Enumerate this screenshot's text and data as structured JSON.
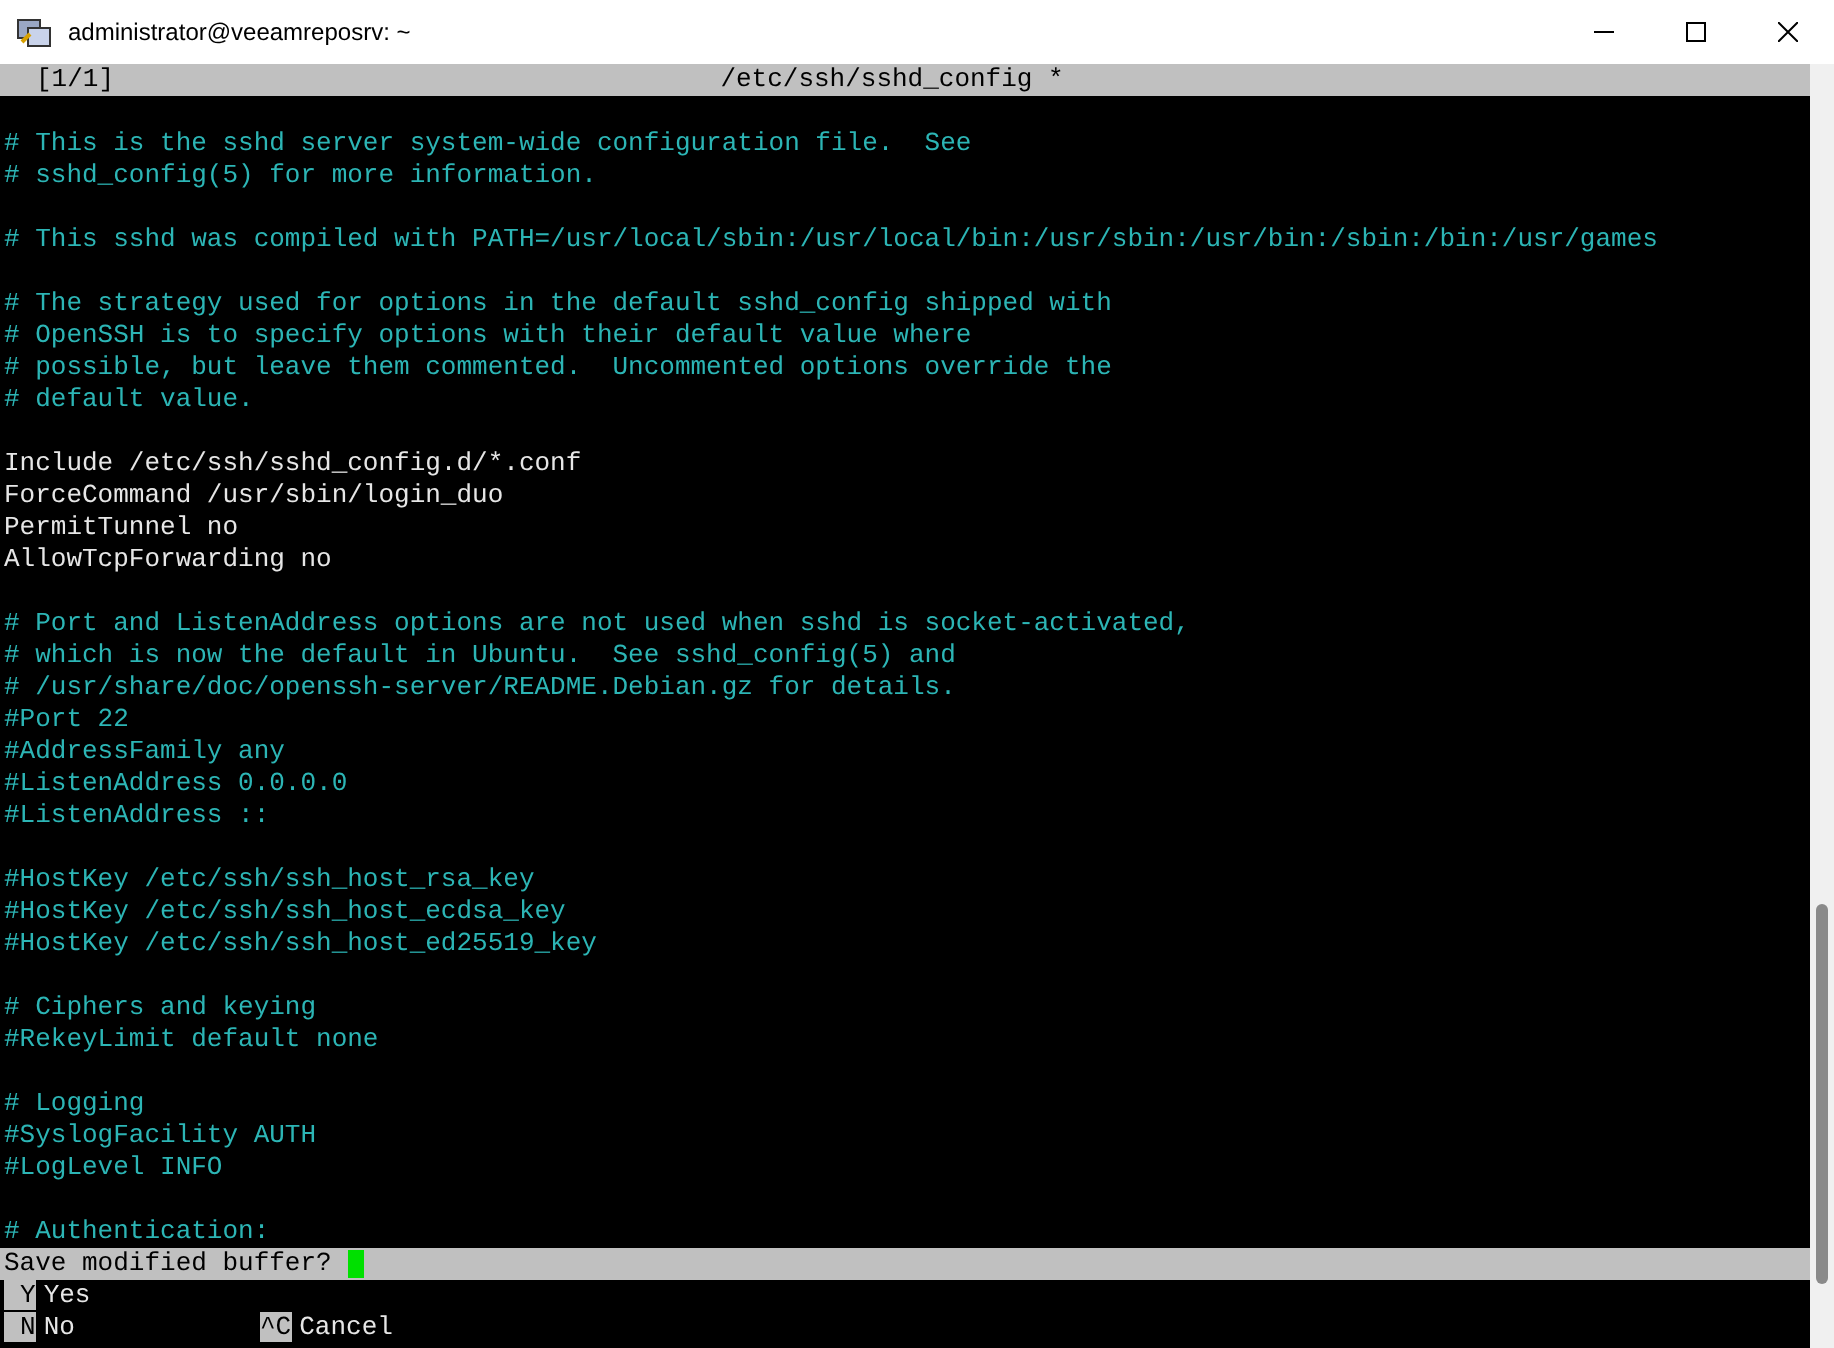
{
  "window": {
    "title": "administrator@veeamreposrv: ~"
  },
  "editor_header": {
    "buffer_count": "[1/1]",
    "file_title": "/etc/ssh/sshd_config *"
  },
  "lines": [
    {
      "kind": "blank"
    },
    {
      "kind": "comment",
      "text": "# This is the sshd server system-wide configuration file.  See"
    },
    {
      "kind": "comment",
      "text": "# sshd_config(5) for more information."
    },
    {
      "kind": "blank"
    },
    {
      "kind": "comment",
      "text": "# This sshd was compiled with PATH=/usr/local/sbin:/usr/local/bin:/usr/sbin:/usr/bin:/sbin:/bin:/usr/games"
    },
    {
      "kind": "blank"
    },
    {
      "kind": "comment",
      "text": "# The strategy used for options in the default sshd_config shipped with"
    },
    {
      "kind": "comment",
      "text": "# OpenSSH is to specify options with their default value where"
    },
    {
      "kind": "comment",
      "text": "# possible, but leave them commented.  Uncommented options override the"
    },
    {
      "kind": "comment",
      "text": "# default value."
    },
    {
      "kind": "blank"
    },
    {
      "kind": "setting",
      "text": "Include /etc/ssh/sshd_config.d/*.conf"
    },
    {
      "kind": "setting",
      "text": "ForceCommand /usr/sbin/login_duo"
    },
    {
      "kind": "setting",
      "text": "PermitTunnel no"
    },
    {
      "kind": "setting",
      "text": "AllowTcpForwarding no"
    },
    {
      "kind": "blank"
    },
    {
      "kind": "comment",
      "text": "# Port and ListenAddress options are not used when sshd is socket-activated,"
    },
    {
      "kind": "comment",
      "text": "# which is now the default in Ubuntu.  See sshd_config(5) and"
    },
    {
      "kind": "comment",
      "text": "# /usr/share/doc/openssh-server/README.Debian.gz for details."
    },
    {
      "kind": "comment",
      "text": "#Port 22"
    },
    {
      "kind": "comment",
      "text": "#AddressFamily any"
    },
    {
      "kind": "comment",
      "text": "#ListenAddress 0.0.0.0"
    },
    {
      "kind": "comment",
      "text": "#ListenAddress ::"
    },
    {
      "kind": "blank"
    },
    {
      "kind": "comment",
      "text": "#HostKey /etc/ssh/ssh_host_rsa_key"
    },
    {
      "kind": "comment",
      "text": "#HostKey /etc/ssh/ssh_host_ecdsa_key"
    },
    {
      "kind": "comment",
      "text": "#HostKey /etc/ssh/ssh_host_ed25519_key"
    },
    {
      "kind": "blank"
    },
    {
      "kind": "comment",
      "text": "# Ciphers and keying"
    },
    {
      "kind": "comment",
      "text": "#RekeyLimit default none"
    },
    {
      "kind": "blank"
    },
    {
      "kind": "comment",
      "text": "# Logging"
    },
    {
      "kind": "comment",
      "text": "#SyslogFacility AUTH"
    },
    {
      "kind": "comment",
      "text": "#LogLevel INFO"
    },
    {
      "kind": "blank"
    },
    {
      "kind": "comment",
      "text": "# Authentication:"
    }
  ],
  "prompt": {
    "text": "Save modified buffer?"
  },
  "shortcut_rows": [
    [
      {
        "key": "Y",
        "label": "Yes"
      }
    ],
    [
      {
        "key": "N",
        "label": "No"
      },
      {
        "key": "^C",
        "label": "Cancel"
      }
    ]
  ]
}
